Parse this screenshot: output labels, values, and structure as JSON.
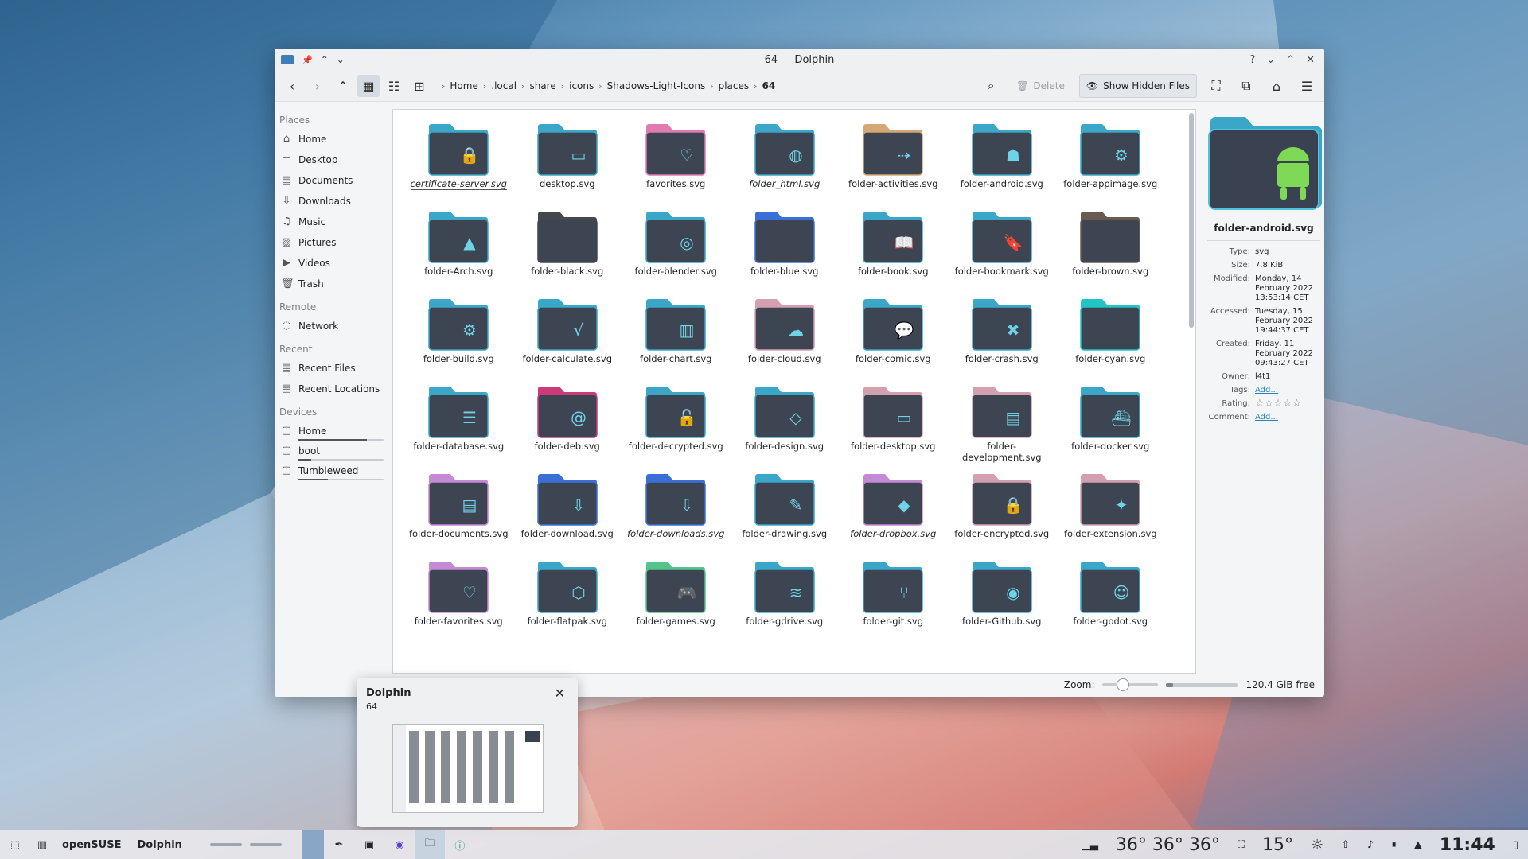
{
  "window": {
    "title": "64 — Dolphin"
  },
  "titlebar": {
    "help": "?",
    "minimize": "⌄",
    "maximize": "⌃",
    "close": "✕"
  },
  "toolbar": {
    "breadcrumb": [
      "Home",
      ".local",
      "share",
      "icons",
      "Shadows-Light-Icons",
      "places",
      "64"
    ],
    "delete_label": "Delete",
    "hidden_label": "Show Hidden Files"
  },
  "sidebar": {
    "places_header": "Places",
    "places": [
      "Home",
      "Desktop",
      "Documents",
      "Downloads",
      "Music",
      "Pictures",
      "Videos",
      "Trash"
    ],
    "remote_header": "Remote",
    "remote": [
      "Network"
    ],
    "recent_header": "Recent",
    "recent": [
      "Recent Files",
      "Recent Locations"
    ],
    "devices_header": "Devices",
    "devices": [
      {
        "label": "Home",
        "usage": 0.8
      },
      {
        "label": "boot",
        "usage": 0.15
      },
      {
        "label": "Tumbleweed",
        "usage": 0.35
      }
    ]
  },
  "files": [
    {
      "name": "certificate-server.svg",
      "color": "#3aa6c8",
      "glyph": "🔒"
    },
    {
      "name": "desktop.svg",
      "color": "#3aa6c8",
      "glyph": "▭"
    },
    {
      "name": "favorites.svg",
      "color": "#e07ab0",
      "glyph": "♡"
    },
    {
      "name": "folder_html.svg",
      "color": "#3aa6c8",
      "glyph": "◍"
    },
    {
      "name": "folder-activities.svg",
      "color": "#d4a875",
      "glyph": "⇢"
    },
    {
      "name": "folder-android.svg",
      "color": "#3aa6c8",
      "glyph": "☗"
    },
    {
      "name": "folder-appimage.svg",
      "color": "#3aa6c8",
      "glyph": "⚙"
    },
    {
      "name": "folder-Arch.svg",
      "color": "#3aa6c8",
      "glyph": "▲"
    },
    {
      "name": "folder-black.svg",
      "color": "#44474c",
      "glyph": ""
    },
    {
      "name": "folder-blender.svg",
      "color": "#3aa6c8",
      "glyph": "◎"
    },
    {
      "name": "folder-blue.svg",
      "color": "#3b6fd8",
      "glyph": ""
    },
    {
      "name": "folder-book.svg",
      "color": "#3aa6c8",
      "glyph": "📖"
    },
    {
      "name": "folder-bookmark.svg",
      "color": "#3aa6c8",
      "glyph": "🔖"
    },
    {
      "name": "folder-brown.svg",
      "color": "#6b5b4e",
      "glyph": ""
    },
    {
      "name": "folder-build.svg",
      "color": "#3aa6c8",
      "glyph": "⚙"
    },
    {
      "name": "folder-calculate.svg",
      "color": "#3aa6c8",
      "glyph": "√"
    },
    {
      "name": "folder-chart.svg",
      "color": "#3aa6c8",
      "glyph": "▥"
    },
    {
      "name": "folder-cloud.svg",
      "color": "#d4a0b0",
      "glyph": "☁"
    },
    {
      "name": "folder-comic.svg",
      "color": "#3aa6c8",
      "glyph": "💬"
    },
    {
      "name": "folder-crash.svg",
      "color": "#3aa6c8",
      "glyph": "✖"
    },
    {
      "name": "folder-cyan.svg",
      "color": "#22c4c4",
      "glyph": ""
    },
    {
      "name": "folder-database.svg",
      "color": "#3aa6c8",
      "glyph": "☰"
    },
    {
      "name": "folder-deb.svg",
      "color": "#d03a7a",
      "glyph": "@"
    },
    {
      "name": "folder-decrypted.svg",
      "color": "#3aa6c8",
      "glyph": "🔓"
    },
    {
      "name": "folder-design.svg",
      "color": "#3aa6c8",
      "glyph": "◇"
    },
    {
      "name": "folder-desktop.svg",
      "color": "#d4a0b0",
      "glyph": "▭"
    },
    {
      "name": "folder-development.svg",
      "color": "#d4a0b0",
      "glyph": "▤"
    },
    {
      "name": "folder-docker.svg",
      "color": "#3aa6c8",
      "glyph": "⛴"
    },
    {
      "name": "folder-documents.svg",
      "color": "#c48ad6",
      "glyph": "▤"
    },
    {
      "name": "folder-download.svg",
      "color": "#3b6fd8",
      "glyph": "⇩"
    },
    {
      "name": "folder-downloads.svg",
      "color": "#3b6fd8",
      "glyph": "⇩"
    },
    {
      "name": "folder-drawing.svg",
      "color": "#3aa6c8",
      "glyph": "✎"
    },
    {
      "name": "folder-dropbox.svg",
      "color": "#c48ad6",
      "glyph": "◆"
    },
    {
      "name": "folder-encrypted.svg",
      "color": "#d4a0b0",
      "glyph": "🔒"
    },
    {
      "name": "folder-extension.svg",
      "color": "#d4a0b0",
      "glyph": "✦"
    },
    {
      "name": "folder-favorites.svg",
      "color": "#c48ad6",
      "glyph": "♡"
    },
    {
      "name": "folder-flatpak.svg",
      "color": "#3aa6c8",
      "glyph": "⬡"
    },
    {
      "name": "folder-games.svg",
      "color": "#55c48a",
      "glyph": "🎮"
    },
    {
      "name": "folder-gdrive.svg",
      "color": "#3aa6c8",
      "glyph": "≋"
    },
    {
      "name": "folder-git.svg",
      "color": "#3aa6c8",
      "glyph": "⑂"
    },
    {
      "name": "folder-Github.svg",
      "color": "#3aa6c8",
      "glyph": "◉"
    },
    {
      "name": "folder-godot.svg",
      "color": "#3aa6c8",
      "glyph": "☺"
    }
  ],
  "info": {
    "filename": "folder-android.svg",
    "rows": [
      {
        "k": "Type:",
        "v": "svg"
      },
      {
        "k": "Size:",
        "v": "7.8 KiB"
      },
      {
        "k": "Modified:",
        "v": "Monday, 14 February 2022 13:53:14 CET"
      },
      {
        "k": "Accessed:",
        "v": "Tuesday, 15 February 2022 19:44:37 CET"
      },
      {
        "k": "Created:",
        "v": "Friday, 11 February 2022 09:43:27 CET"
      },
      {
        "k": "Owner:",
        "v": "l4t1"
      }
    ],
    "tags_label": "Tags:",
    "tags_link": "Add...",
    "rating_label": "Rating:",
    "rating_stars": "☆☆☆☆☆",
    "comment_label": "Comment:",
    "comment_link": "Add..."
  },
  "status": {
    "zoom_label": "Zoom:",
    "zoom_level": 0.35,
    "free_space": "120.4 GiB free",
    "space_used": 0.1
  },
  "tooltip": {
    "title": "Dolphin",
    "subtitle": "64",
    "close": "✕"
  },
  "panel": {
    "distro": "openSUSE",
    "active_app": "Dolphin",
    "temps": "36°  36°  36°",
    "weather": "15°",
    "clock": "11:44"
  }
}
